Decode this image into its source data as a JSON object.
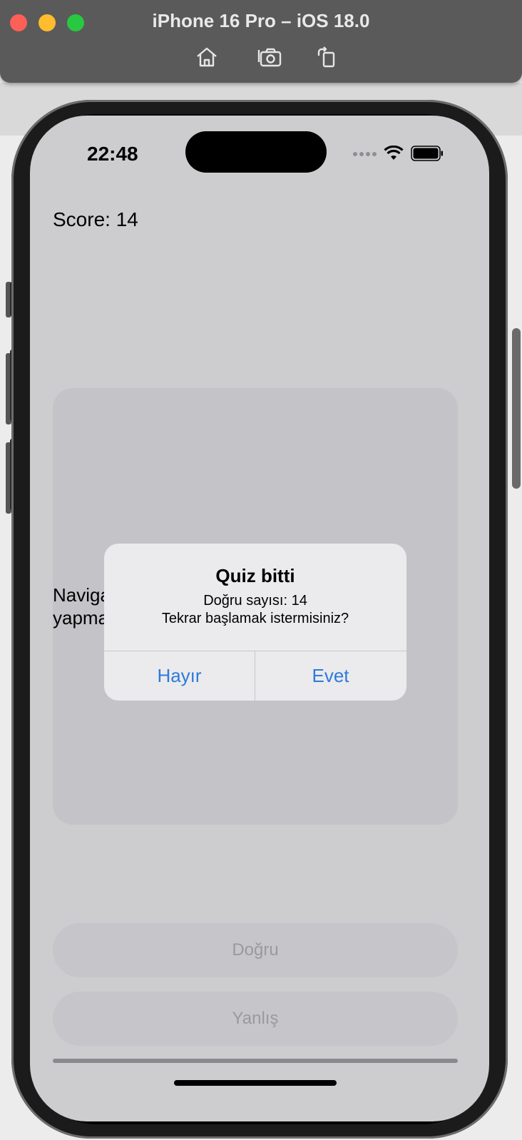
{
  "window": {
    "title": "iPhone 16 Pro – iOS 18.0",
    "toolbar": [
      "home-icon",
      "screenshot-icon",
      "rotate-icon"
    ]
  },
  "status_bar": {
    "time": "22:48"
  },
  "app": {
    "score_label": "Score: 14",
    "question_visible": "Naviga\nyapma",
    "answer_true": "Doğru",
    "answer_false": "Yanlış"
  },
  "alert": {
    "title": "Quiz bitti",
    "message_line1": "Doğru sayısı: 14",
    "message_line2": "Tekrar başlamak istermisiniz?",
    "button_no": "Hayır",
    "button_yes": "Evet",
    "accent": "#2f7ad9"
  }
}
